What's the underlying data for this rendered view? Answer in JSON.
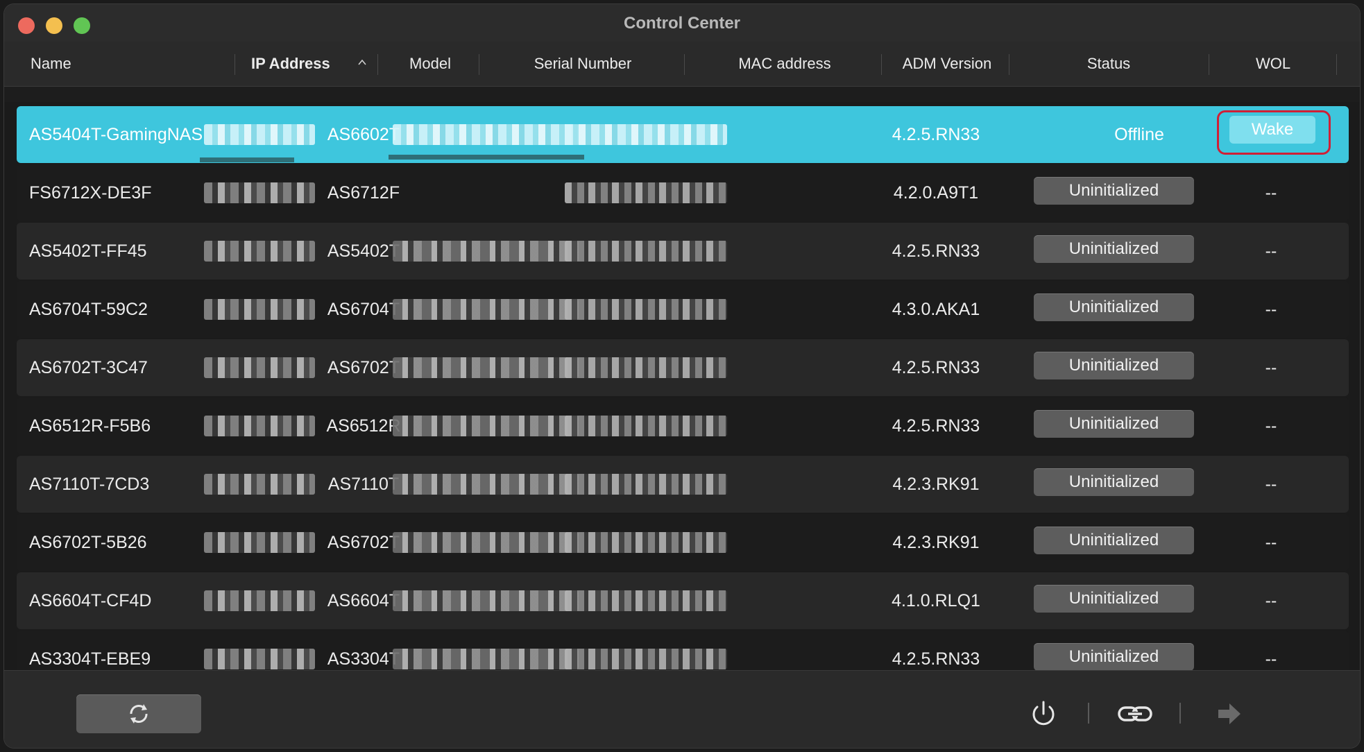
{
  "window": {
    "title": "Control Center"
  },
  "columns": {
    "name": "Name",
    "ip": "IP Address",
    "model": "Model",
    "serial": "Serial Number",
    "mac": "MAC address",
    "adm": "ADM Version",
    "status": "Status",
    "wol": "WOL"
  },
  "sort": {
    "column": "ip",
    "direction": "ascending",
    "icon": "chevron-up-icon"
  },
  "rows": [
    {
      "name": "AS5404T-GamingNAS",
      "model": "AS6602T",
      "adm": "4.2.5.RN33",
      "status": "Offline",
      "wol": "Wake",
      "selected": true
    },
    {
      "name": "FS6712X-DE3F",
      "model": "AS6712F",
      "adm": "4.2.0.A9T1",
      "status": "Uninitialized",
      "wol": "--"
    },
    {
      "name": "AS5402T-FF45",
      "model": "AS5402T",
      "adm": "4.2.5.RN33",
      "status": "Uninitialized",
      "wol": "--"
    },
    {
      "name": "AS6704T-59C2",
      "model": "AS6704T",
      "adm": "4.3.0.AKA1",
      "status": "Uninitialized",
      "wol": "--"
    },
    {
      "name": "AS6702T-3C47",
      "model": "AS6702T",
      "adm": "4.2.5.RN33",
      "status": "Uninitialized",
      "wol": "--"
    },
    {
      "name": "AS6512R-F5B6",
      "model": "AS6512R",
      "adm": "4.2.5.RN33",
      "status": "Uninitialized",
      "wol": "--"
    },
    {
      "name": "AS7110T-7CD3",
      "model": "AS7110T",
      "adm": "4.2.3.RK91",
      "status": "Uninitialized",
      "wol": "--"
    },
    {
      "name": "AS6702T-5B26",
      "model": "AS6702T",
      "adm": "4.2.3.RK91",
      "status": "Uninitialized",
      "wol": "--"
    },
    {
      "name": "AS6604T-CF4D",
      "model": "AS6604T",
      "adm": "4.1.0.RLQ1",
      "status": "Uninitialized",
      "wol": "--"
    },
    {
      "name": "AS3304T-EBE9",
      "model": "AS3304T",
      "adm": "4.2.5.RN33",
      "status": "Uninitialized",
      "wol": "--"
    }
  ],
  "footer": {
    "refresh_icon": "refresh-icon",
    "power_icon": "power-icon",
    "link_icon": "link-icon",
    "arrow_icon": "arrow-right-icon"
  },
  "colors": {
    "selected_row": "#3ec6dd",
    "highlight_ring": "#d01f36",
    "status_button": "#5d5d5d"
  }
}
